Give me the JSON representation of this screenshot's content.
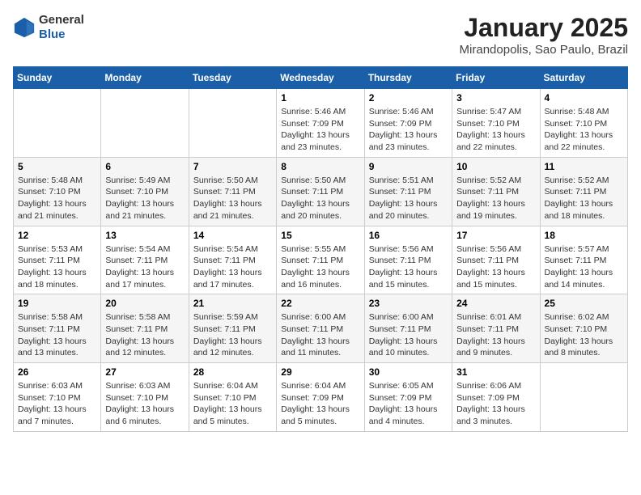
{
  "header": {
    "logo_line1": "General",
    "logo_line2": "Blue",
    "month": "January 2025",
    "location": "Mirandopolis, Sao Paulo, Brazil"
  },
  "weekdays": [
    "Sunday",
    "Monday",
    "Tuesday",
    "Wednesday",
    "Thursday",
    "Friday",
    "Saturday"
  ],
  "weeks": [
    [
      {
        "day": "",
        "info": ""
      },
      {
        "day": "",
        "info": ""
      },
      {
        "day": "",
        "info": ""
      },
      {
        "day": "1",
        "info": "Sunrise: 5:46 AM\nSunset: 7:09 PM\nDaylight: 13 hours and 23 minutes."
      },
      {
        "day": "2",
        "info": "Sunrise: 5:46 AM\nSunset: 7:09 PM\nDaylight: 13 hours and 23 minutes."
      },
      {
        "day": "3",
        "info": "Sunrise: 5:47 AM\nSunset: 7:10 PM\nDaylight: 13 hours and 22 minutes."
      },
      {
        "day": "4",
        "info": "Sunrise: 5:48 AM\nSunset: 7:10 PM\nDaylight: 13 hours and 22 minutes."
      }
    ],
    [
      {
        "day": "5",
        "info": "Sunrise: 5:48 AM\nSunset: 7:10 PM\nDaylight: 13 hours and 21 minutes."
      },
      {
        "day": "6",
        "info": "Sunrise: 5:49 AM\nSunset: 7:10 PM\nDaylight: 13 hours and 21 minutes."
      },
      {
        "day": "7",
        "info": "Sunrise: 5:50 AM\nSunset: 7:11 PM\nDaylight: 13 hours and 21 minutes."
      },
      {
        "day": "8",
        "info": "Sunrise: 5:50 AM\nSunset: 7:11 PM\nDaylight: 13 hours and 20 minutes."
      },
      {
        "day": "9",
        "info": "Sunrise: 5:51 AM\nSunset: 7:11 PM\nDaylight: 13 hours and 20 minutes."
      },
      {
        "day": "10",
        "info": "Sunrise: 5:52 AM\nSunset: 7:11 PM\nDaylight: 13 hours and 19 minutes."
      },
      {
        "day": "11",
        "info": "Sunrise: 5:52 AM\nSunset: 7:11 PM\nDaylight: 13 hours and 18 minutes."
      }
    ],
    [
      {
        "day": "12",
        "info": "Sunrise: 5:53 AM\nSunset: 7:11 PM\nDaylight: 13 hours and 18 minutes."
      },
      {
        "day": "13",
        "info": "Sunrise: 5:54 AM\nSunset: 7:11 PM\nDaylight: 13 hours and 17 minutes."
      },
      {
        "day": "14",
        "info": "Sunrise: 5:54 AM\nSunset: 7:11 PM\nDaylight: 13 hours and 17 minutes."
      },
      {
        "day": "15",
        "info": "Sunrise: 5:55 AM\nSunset: 7:11 PM\nDaylight: 13 hours and 16 minutes."
      },
      {
        "day": "16",
        "info": "Sunrise: 5:56 AM\nSunset: 7:11 PM\nDaylight: 13 hours and 15 minutes."
      },
      {
        "day": "17",
        "info": "Sunrise: 5:56 AM\nSunset: 7:11 PM\nDaylight: 13 hours and 15 minutes."
      },
      {
        "day": "18",
        "info": "Sunrise: 5:57 AM\nSunset: 7:11 PM\nDaylight: 13 hours and 14 minutes."
      }
    ],
    [
      {
        "day": "19",
        "info": "Sunrise: 5:58 AM\nSunset: 7:11 PM\nDaylight: 13 hours and 13 minutes."
      },
      {
        "day": "20",
        "info": "Sunrise: 5:58 AM\nSunset: 7:11 PM\nDaylight: 13 hours and 12 minutes."
      },
      {
        "day": "21",
        "info": "Sunrise: 5:59 AM\nSunset: 7:11 PM\nDaylight: 13 hours and 12 minutes."
      },
      {
        "day": "22",
        "info": "Sunrise: 6:00 AM\nSunset: 7:11 PM\nDaylight: 13 hours and 11 minutes."
      },
      {
        "day": "23",
        "info": "Sunrise: 6:00 AM\nSunset: 7:11 PM\nDaylight: 13 hours and 10 minutes."
      },
      {
        "day": "24",
        "info": "Sunrise: 6:01 AM\nSunset: 7:11 PM\nDaylight: 13 hours and 9 minutes."
      },
      {
        "day": "25",
        "info": "Sunrise: 6:02 AM\nSunset: 7:10 PM\nDaylight: 13 hours and 8 minutes."
      }
    ],
    [
      {
        "day": "26",
        "info": "Sunrise: 6:03 AM\nSunset: 7:10 PM\nDaylight: 13 hours and 7 minutes."
      },
      {
        "day": "27",
        "info": "Sunrise: 6:03 AM\nSunset: 7:10 PM\nDaylight: 13 hours and 6 minutes."
      },
      {
        "day": "28",
        "info": "Sunrise: 6:04 AM\nSunset: 7:10 PM\nDaylight: 13 hours and 5 minutes."
      },
      {
        "day": "29",
        "info": "Sunrise: 6:04 AM\nSunset: 7:09 PM\nDaylight: 13 hours and 5 minutes."
      },
      {
        "day": "30",
        "info": "Sunrise: 6:05 AM\nSunset: 7:09 PM\nDaylight: 13 hours and 4 minutes."
      },
      {
        "day": "31",
        "info": "Sunrise: 6:06 AM\nSunset: 7:09 PM\nDaylight: 13 hours and 3 minutes."
      },
      {
        "day": "",
        "info": ""
      }
    ]
  ]
}
